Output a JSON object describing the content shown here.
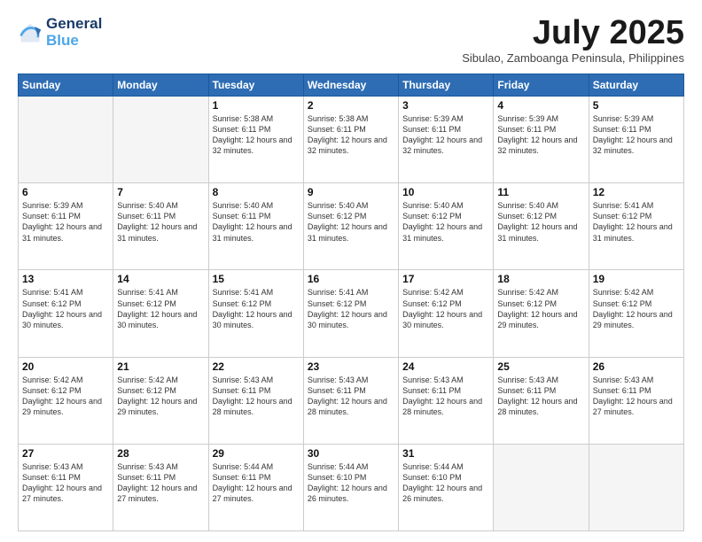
{
  "logo": {
    "line1": "General",
    "line2": "Blue"
  },
  "title": "July 2025",
  "subtitle": "Sibulao, Zamboanga Peninsula, Philippines",
  "weekdays": [
    "Sunday",
    "Monday",
    "Tuesday",
    "Wednesday",
    "Thursday",
    "Friday",
    "Saturday"
  ],
  "weeks": [
    [
      {
        "day": "",
        "info": ""
      },
      {
        "day": "",
        "info": ""
      },
      {
        "day": "1",
        "info": "Sunrise: 5:38 AM\nSunset: 6:11 PM\nDaylight: 12 hours\nand 32 minutes."
      },
      {
        "day": "2",
        "info": "Sunrise: 5:38 AM\nSunset: 6:11 PM\nDaylight: 12 hours\nand 32 minutes."
      },
      {
        "day": "3",
        "info": "Sunrise: 5:39 AM\nSunset: 6:11 PM\nDaylight: 12 hours\nand 32 minutes."
      },
      {
        "day": "4",
        "info": "Sunrise: 5:39 AM\nSunset: 6:11 PM\nDaylight: 12 hours\nand 32 minutes."
      },
      {
        "day": "5",
        "info": "Sunrise: 5:39 AM\nSunset: 6:11 PM\nDaylight: 12 hours\nand 32 minutes."
      }
    ],
    [
      {
        "day": "6",
        "info": "Sunrise: 5:39 AM\nSunset: 6:11 PM\nDaylight: 12 hours\nand 31 minutes."
      },
      {
        "day": "7",
        "info": "Sunrise: 5:40 AM\nSunset: 6:11 PM\nDaylight: 12 hours\nand 31 minutes."
      },
      {
        "day": "8",
        "info": "Sunrise: 5:40 AM\nSunset: 6:11 PM\nDaylight: 12 hours\nand 31 minutes."
      },
      {
        "day": "9",
        "info": "Sunrise: 5:40 AM\nSunset: 6:12 PM\nDaylight: 12 hours\nand 31 minutes."
      },
      {
        "day": "10",
        "info": "Sunrise: 5:40 AM\nSunset: 6:12 PM\nDaylight: 12 hours\nand 31 minutes."
      },
      {
        "day": "11",
        "info": "Sunrise: 5:40 AM\nSunset: 6:12 PM\nDaylight: 12 hours\nand 31 minutes."
      },
      {
        "day": "12",
        "info": "Sunrise: 5:41 AM\nSunset: 6:12 PM\nDaylight: 12 hours\nand 31 minutes."
      }
    ],
    [
      {
        "day": "13",
        "info": "Sunrise: 5:41 AM\nSunset: 6:12 PM\nDaylight: 12 hours\nand 30 minutes."
      },
      {
        "day": "14",
        "info": "Sunrise: 5:41 AM\nSunset: 6:12 PM\nDaylight: 12 hours\nand 30 minutes."
      },
      {
        "day": "15",
        "info": "Sunrise: 5:41 AM\nSunset: 6:12 PM\nDaylight: 12 hours\nand 30 minutes."
      },
      {
        "day": "16",
        "info": "Sunrise: 5:41 AM\nSunset: 6:12 PM\nDaylight: 12 hours\nand 30 minutes."
      },
      {
        "day": "17",
        "info": "Sunrise: 5:42 AM\nSunset: 6:12 PM\nDaylight: 12 hours\nand 30 minutes."
      },
      {
        "day": "18",
        "info": "Sunrise: 5:42 AM\nSunset: 6:12 PM\nDaylight: 12 hours\nand 29 minutes."
      },
      {
        "day": "19",
        "info": "Sunrise: 5:42 AM\nSunset: 6:12 PM\nDaylight: 12 hours\nand 29 minutes."
      }
    ],
    [
      {
        "day": "20",
        "info": "Sunrise: 5:42 AM\nSunset: 6:12 PM\nDaylight: 12 hours\nand 29 minutes."
      },
      {
        "day": "21",
        "info": "Sunrise: 5:42 AM\nSunset: 6:12 PM\nDaylight: 12 hours\nand 29 minutes."
      },
      {
        "day": "22",
        "info": "Sunrise: 5:43 AM\nSunset: 6:11 PM\nDaylight: 12 hours\nand 28 minutes."
      },
      {
        "day": "23",
        "info": "Sunrise: 5:43 AM\nSunset: 6:11 PM\nDaylight: 12 hours\nand 28 minutes."
      },
      {
        "day": "24",
        "info": "Sunrise: 5:43 AM\nSunset: 6:11 PM\nDaylight: 12 hours\nand 28 minutes."
      },
      {
        "day": "25",
        "info": "Sunrise: 5:43 AM\nSunset: 6:11 PM\nDaylight: 12 hours\nand 28 minutes."
      },
      {
        "day": "26",
        "info": "Sunrise: 5:43 AM\nSunset: 6:11 PM\nDaylight: 12 hours\nand 27 minutes."
      }
    ],
    [
      {
        "day": "27",
        "info": "Sunrise: 5:43 AM\nSunset: 6:11 PM\nDaylight: 12 hours\nand 27 minutes."
      },
      {
        "day": "28",
        "info": "Sunrise: 5:43 AM\nSunset: 6:11 PM\nDaylight: 12 hours\nand 27 minutes."
      },
      {
        "day": "29",
        "info": "Sunrise: 5:44 AM\nSunset: 6:11 PM\nDaylight: 12 hours\nand 27 minutes."
      },
      {
        "day": "30",
        "info": "Sunrise: 5:44 AM\nSunset: 6:10 PM\nDaylight: 12 hours\nand 26 minutes."
      },
      {
        "day": "31",
        "info": "Sunrise: 5:44 AM\nSunset: 6:10 PM\nDaylight: 12 hours\nand 26 minutes."
      },
      {
        "day": "",
        "info": ""
      },
      {
        "day": "",
        "info": ""
      }
    ]
  ]
}
